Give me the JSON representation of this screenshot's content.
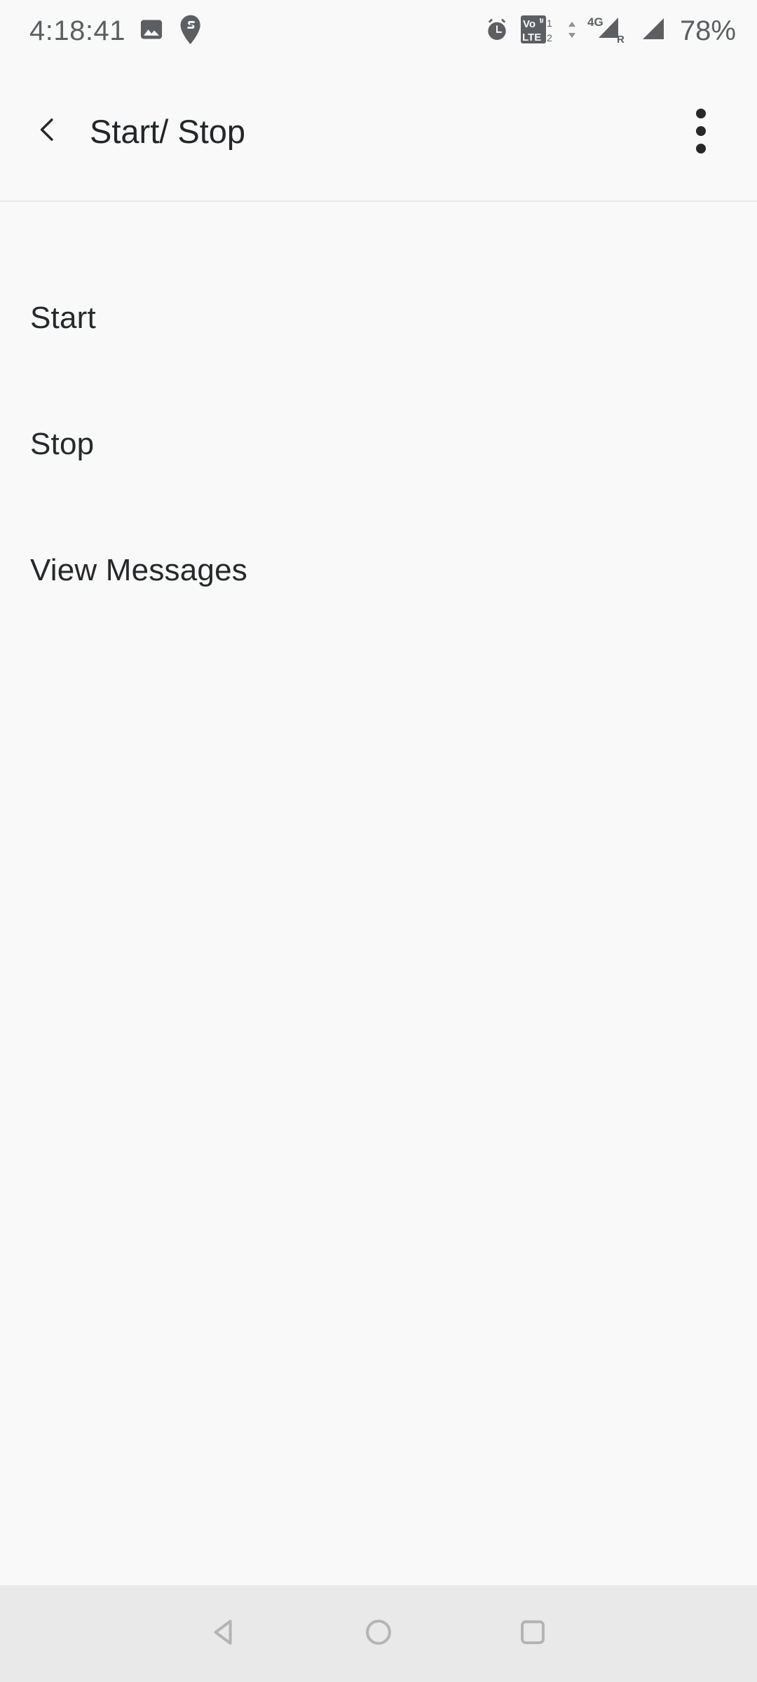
{
  "theme": {
    "background": "#f9f9f9",
    "text_primary": "#26292b",
    "text_status": "#5b5f63",
    "divider": "#e8e8e8",
    "navbar_bg": "#e9e9e9",
    "navbar_icon": "#b4b4b4"
  },
  "status_bar": {
    "clock": "4:18:41",
    "battery_percent": "78%",
    "left_icons": [
      {
        "name": "image-icon",
        "label": "image"
      },
      {
        "name": "location-pin-icon",
        "label": "location pin"
      }
    ],
    "right_icons": [
      {
        "name": "alarm-clock-icon",
        "label": "alarm"
      },
      {
        "name": "volte-dual-sim-icon",
        "label": "VoLTE 1 2",
        "vo_text": "Vo",
        "lte_text": "LTE",
        "sim1": "1",
        "sim2": "2"
      },
      {
        "name": "mobile-data-arrows-icon",
        "label": "data transfer"
      },
      {
        "name": "signal-4g-roaming-icon",
        "label": "4G signal roaming",
        "network": "4G",
        "roaming": "R"
      },
      {
        "name": "signal-bars-icon",
        "label": "signal strength"
      }
    ]
  },
  "app_bar": {
    "back_icon": "chevron-left-icon",
    "title": "Start/ Stop",
    "overflow_icon": "more-vertical-icon"
  },
  "main": {
    "items": [
      {
        "label": "Start",
        "name": "list-item-start"
      },
      {
        "label": "Stop",
        "name": "list-item-stop"
      },
      {
        "label": "View Messages",
        "name": "list-item-view-messages"
      }
    ]
  },
  "nav_bar": {
    "buttons": [
      {
        "name": "nav-back-button",
        "label": "Back",
        "icon": "triangle-left-icon"
      },
      {
        "name": "nav-home-button",
        "label": "Home",
        "icon": "circle-icon"
      },
      {
        "name": "nav-recents-button",
        "label": "Recents",
        "icon": "square-icon"
      }
    ]
  }
}
